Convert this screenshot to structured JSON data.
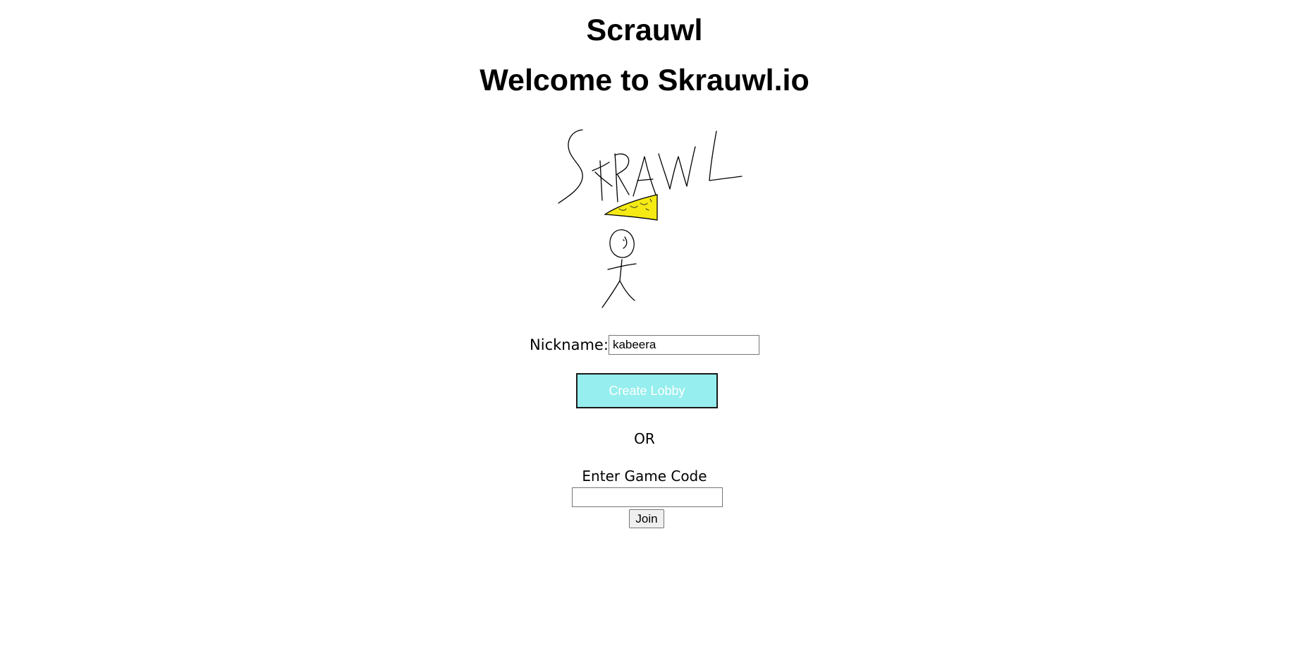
{
  "header": {
    "title": "Scrauwl",
    "welcome": "Welcome to Skrauwl.io"
  },
  "logo": {
    "icon": "hand-drawn-stick-figure-logo",
    "text": "SKRAWL",
    "hat_color": "#f5ea14"
  },
  "nickname": {
    "label": "Nickname:",
    "value": "kabeera"
  },
  "create_lobby": {
    "label": "Create Lobby",
    "bg_color": "#96eeee"
  },
  "separator": "OR",
  "game_code": {
    "label": "Enter Game Code",
    "value": "",
    "join_label": "Join"
  }
}
